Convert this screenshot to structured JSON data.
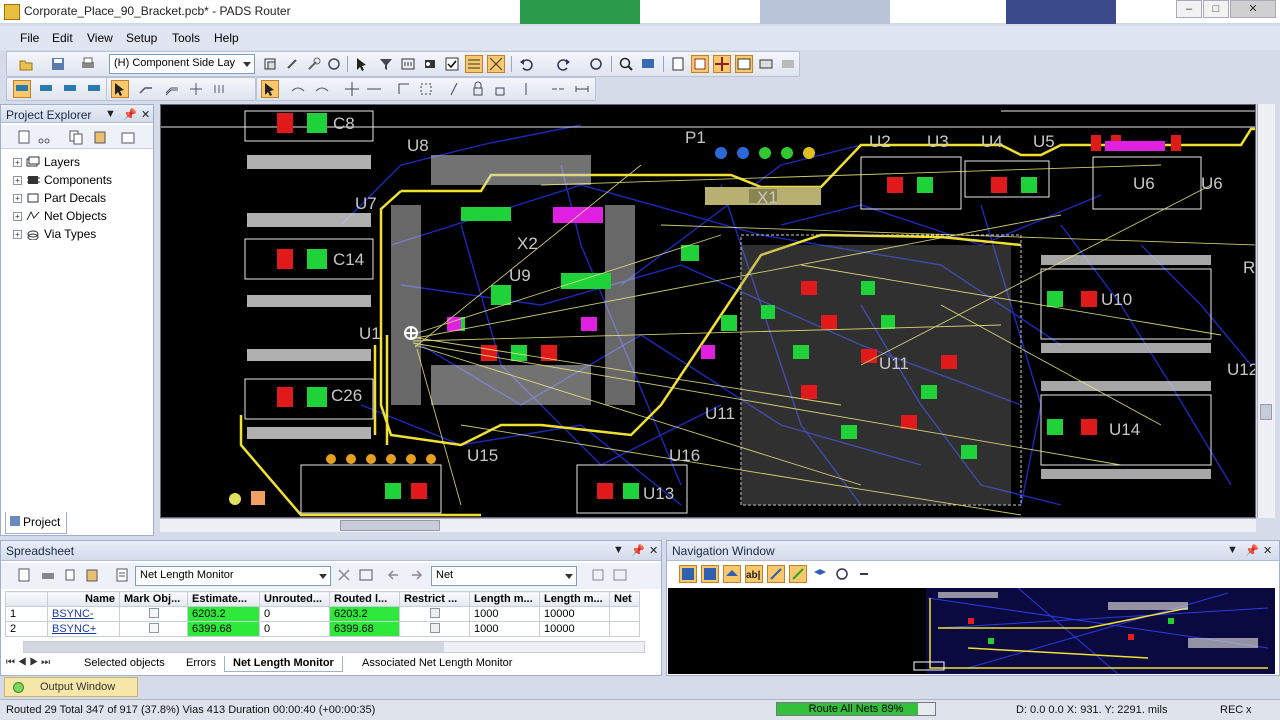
{
  "window": {
    "title": "Corporate_Place_90_Bracket.pcb* - PADS Router"
  },
  "menu": [
    "File",
    "Edit",
    "View",
    "Setup",
    "Tools",
    "Help"
  ],
  "toolbar": {
    "layer_select": "(H) Component Side Lay"
  },
  "project_explorer": {
    "title": "Project Explorer",
    "items": [
      {
        "label": "Layers",
        "icon": "layers-icon"
      },
      {
        "label": "Components",
        "icon": "chip-icon"
      },
      {
        "label": "Part Decals",
        "icon": "decal-icon"
      },
      {
        "label": "Net Objects",
        "icon": "net-icon"
      },
      {
        "label": "Via Types",
        "icon": "via-icon"
      }
    ],
    "tab": "Project"
  },
  "pcb": {
    "ref_designators": [
      "C8",
      "U8",
      "P1",
      "U2",
      "U3",
      "U4",
      "U5",
      "U6",
      "U7",
      "X1",
      "X2",
      "U9",
      "C14",
      "U10",
      "U1",
      "U11",
      "C26",
      "U14",
      "U12",
      "U15",
      "U16",
      "U13",
      "R"
    ]
  },
  "spreadsheet": {
    "title": "Spreadsheet",
    "view_select": "Net Length Monitor",
    "filter_select": "Net",
    "columns": [
      "",
      "Name",
      "Mark Obj...",
      "Estimate...",
      "Unrouted...",
      "Routed l...",
      "Restrict ...",
      "Length m...",
      "Length m...",
      "Net"
    ],
    "rows": [
      {
        "num": "1",
        "name": "BSYNC-",
        "estimate": "6203.2",
        "unrouted": "0",
        "routed": "6203.2",
        "len_min": "1000",
        "len_max": "10000"
      },
      {
        "num": "2",
        "name": "BSYNC+",
        "estimate": "6399.68",
        "unrouted": "0",
        "routed": "6399.68",
        "len_min": "1000",
        "len_max": "10000"
      }
    ],
    "tabs": [
      "Selected objects",
      "Errors",
      "Net Length Monitor",
      "Associated Net Length Monitor"
    ],
    "active_tab": "Net Length Monitor"
  },
  "navigation": {
    "title": "Navigation Window"
  },
  "output": {
    "tab": "Output Window"
  },
  "status": {
    "left": "Routed 29  Total 347 of 917 (37.8%)  Vias 413  Duration 00:00:40  (+00:00:35)",
    "progress_label": "Route All Nets 89%",
    "progress": 0.89,
    "coords": "D: 0.0 0.0  X:  931.  Y: 2291.  mils",
    "rec": "REC",
    "x": "x"
  }
}
